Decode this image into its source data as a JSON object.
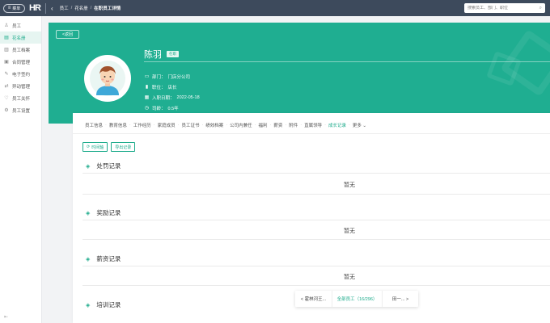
{
  "topbar": {
    "menu_label": "菜单",
    "logo_text": "HR",
    "breadcrumbs": [
      "员工",
      "花名册",
      "在职员工详情"
    ],
    "search_placeholder": "搜索员工、部门、职位"
  },
  "sidebar": {
    "items": [
      {
        "icon": "person-icon",
        "glyph": "♙",
        "label": "员工"
      },
      {
        "icon": "roster-icon",
        "glyph": "▤",
        "label": "花名册"
      },
      {
        "icon": "file-icon",
        "glyph": "▥",
        "label": "员工档案"
      },
      {
        "icon": "contract-icon",
        "glyph": "▣",
        "label": "合同管理"
      },
      {
        "icon": "sign-icon",
        "glyph": "✎",
        "label": "电子签约"
      },
      {
        "icon": "change-icon",
        "glyph": "⇄",
        "label": "异动管理"
      },
      {
        "icon": "care-icon",
        "glyph": "♡",
        "label": "员工关怀"
      },
      {
        "icon": "settings-icon",
        "glyph": "⚙",
        "label": "员工设置"
      }
    ]
  },
  "profile": {
    "return_label": "<返回",
    "name": "陈羽",
    "status": "在职",
    "department_label": "部门：",
    "department": "门店分公司",
    "position_label": "职位：",
    "position": "店长",
    "hire_date_label": "入职日期：",
    "hire_date": "2022-05-18",
    "tenure_label": "司龄：",
    "tenure": "0.5年"
  },
  "tabs": [
    "员工信息",
    "教育信息",
    "工作经历",
    "家庭成员",
    "员工证书",
    "绩效档案",
    "公司内兼任",
    "福利",
    "薪资",
    "附件",
    "直属领导",
    "成长记录",
    "更多"
  ],
  "active_tab": "成长记录",
  "buttons": {
    "timeline": "时间轴",
    "export": "导出记录"
  },
  "sections": [
    {
      "title": "处罚记录",
      "empty": "暂无"
    },
    {
      "title": "奖励记录",
      "empty": "暂无"
    },
    {
      "title": "薪资记录",
      "empty": "暂无"
    },
    {
      "title": "培训记录",
      "empty": ""
    }
  ],
  "pager": {
    "prev": "< 霍林河王...",
    "current": "全部员工（16/296）",
    "next": "田一... >"
  },
  "colors": {
    "brand": "#1fae91",
    "topbar": "#3d4a5c"
  }
}
